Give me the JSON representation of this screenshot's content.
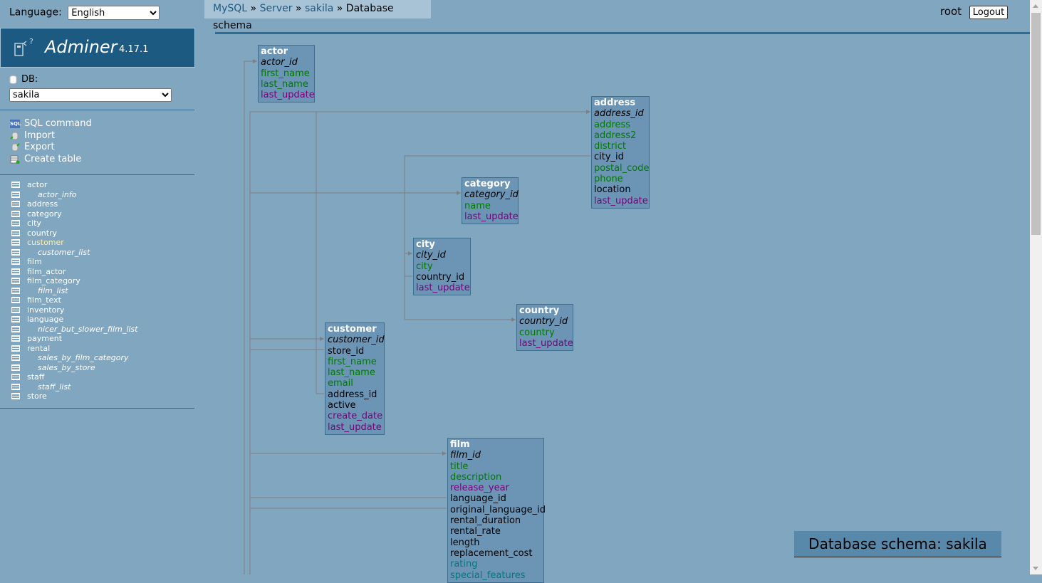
{
  "language": {
    "label": "Language:",
    "selected": "English"
  },
  "logo": {
    "name": "Adminer",
    "version": "4.17.1"
  },
  "db": {
    "label": "DB:",
    "selected": "sakila"
  },
  "actions": [
    {
      "label": "SQL command",
      "icon": "sql-icon"
    },
    {
      "label": "Import",
      "icon": "import-icon"
    },
    {
      "label": "Export",
      "icon": "export-icon"
    },
    {
      "label": "Create table",
      "icon": "create-table-icon"
    }
  ],
  "tables": [
    {
      "name": "actor",
      "view": false,
      "current": false
    },
    {
      "name": "actor_info",
      "view": true,
      "current": false
    },
    {
      "name": "address",
      "view": false,
      "current": false
    },
    {
      "name": "category",
      "view": false,
      "current": false
    },
    {
      "name": "city",
      "view": false,
      "current": false
    },
    {
      "name": "country",
      "view": false,
      "current": false
    },
    {
      "name": "customer",
      "view": false,
      "current": true
    },
    {
      "name": "customer_list",
      "view": true,
      "current": false
    },
    {
      "name": "film",
      "view": false,
      "current": false
    },
    {
      "name": "film_actor",
      "view": false,
      "current": false
    },
    {
      "name": "film_category",
      "view": false,
      "current": false
    },
    {
      "name": "film_list",
      "view": true,
      "current": false
    },
    {
      "name": "film_text",
      "view": false,
      "current": false
    },
    {
      "name": "inventory",
      "view": false,
      "current": false
    },
    {
      "name": "language",
      "view": false,
      "current": false
    },
    {
      "name": "nicer_but_slower_film_list",
      "view": true,
      "current": false
    },
    {
      "name": "payment",
      "view": false,
      "current": false
    },
    {
      "name": "rental",
      "view": false,
      "current": false
    },
    {
      "name": "sales_by_film_category",
      "view": true,
      "current": false
    },
    {
      "name": "sales_by_store",
      "view": true,
      "current": false
    },
    {
      "name": "staff",
      "view": false,
      "current": false
    },
    {
      "name": "staff_list",
      "view": true,
      "current": false
    },
    {
      "name": "store",
      "view": false,
      "current": false
    }
  ],
  "breadcrumb": {
    "mysql": "MySQL",
    "server": "Server",
    "db": "sakila",
    "current": "Database schema",
    "sep": "»"
  },
  "user": {
    "name": "root",
    "logout": "Logout"
  },
  "schema_tables": [
    {
      "name": "actor",
      "fields": [
        {
          "n": "actor_id",
          "pk": true,
          "color": "black"
        },
        {
          "n": "first_name",
          "color": "green"
        },
        {
          "n": "last_name",
          "color": "green"
        },
        {
          "n": "last_update",
          "color": "purple"
        }
      ]
    },
    {
      "name": "address",
      "fields": [
        {
          "n": "address_id",
          "pk": true,
          "color": "black"
        },
        {
          "n": "address",
          "color": "green"
        },
        {
          "n": "address2",
          "color": "green"
        },
        {
          "n": "district",
          "color": "green"
        },
        {
          "n": "city_id",
          "color": "black"
        },
        {
          "n": "postal_code",
          "color": "green"
        },
        {
          "n": "phone",
          "color": "green"
        },
        {
          "n": "location",
          "color": "black"
        },
        {
          "n": "last_update",
          "color": "purple"
        }
      ]
    },
    {
      "name": "category",
      "fields": [
        {
          "n": "category_id",
          "pk": true,
          "color": "black"
        },
        {
          "n": "name",
          "color": "green"
        },
        {
          "n": "last_update",
          "color": "purple"
        }
      ]
    },
    {
      "name": "city",
      "fields": [
        {
          "n": "city_id",
          "pk": true,
          "color": "black"
        },
        {
          "n": "city",
          "color": "green"
        },
        {
          "n": "country_id",
          "color": "black"
        },
        {
          "n": "last_update",
          "color": "purple"
        }
      ]
    },
    {
      "name": "country",
      "fields": [
        {
          "n": "country_id",
          "pk": true,
          "color": "black"
        },
        {
          "n": "country",
          "color": "green"
        },
        {
          "n": "last_update",
          "color": "purple"
        }
      ]
    },
    {
      "name": "customer",
      "fields": [
        {
          "n": "customer_id",
          "pk": true,
          "color": "black"
        },
        {
          "n": "store_id",
          "color": "black"
        },
        {
          "n": "first_name",
          "color": "green"
        },
        {
          "n": "last_name",
          "color": "green"
        },
        {
          "n": "email",
          "color": "green"
        },
        {
          "n": "address_id",
          "color": "black"
        },
        {
          "n": "active",
          "color": "black"
        },
        {
          "n": "create_date",
          "color": "purple"
        },
        {
          "n": "last_update",
          "color": "purple"
        }
      ]
    },
    {
      "name": "film",
      "fields": [
        {
          "n": "film_id",
          "pk": true,
          "color": "black"
        },
        {
          "n": "title",
          "color": "green"
        },
        {
          "n": "description",
          "color": "green"
        },
        {
          "n": "release_year",
          "color": "purple"
        },
        {
          "n": "language_id",
          "color": "black"
        },
        {
          "n": "original_language_id",
          "color": "black"
        },
        {
          "n": "rental_duration",
          "color": "black"
        },
        {
          "n": "rental_rate",
          "color": "black"
        },
        {
          "n": "length",
          "color": "black"
        },
        {
          "n": "replacement_cost",
          "color": "black"
        },
        {
          "n": "rating",
          "color": "teal"
        },
        {
          "n": "special_features",
          "color": "teal"
        }
      ]
    }
  ],
  "caption": "Database schema: sakila",
  "colors": {
    "background": "#80a6c0",
    "table": "#6b94b5",
    "logo": "#1c5a82",
    "link": "#1c5a82"
  }
}
